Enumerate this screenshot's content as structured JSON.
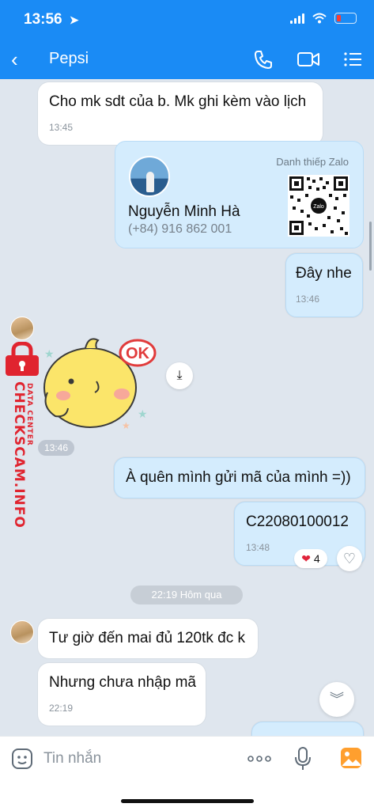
{
  "status_bar": {
    "time": "13:56"
  },
  "header": {
    "title": "Pepsi"
  },
  "messages": {
    "m1": {
      "text": "Cho mk sdt của b. Mk ghi kèm vào lịch",
      "time": "13:45"
    },
    "card": {
      "label": "Danh thiếp Zalo",
      "name": "Nguyễn Minh Hà",
      "phone": "(+84) 916 862 001",
      "qr_badge": "Zalo"
    },
    "m2": {
      "text": "Đây nhe",
      "time": "13:46"
    },
    "sticker": {
      "text": "OK",
      "time": "13:46"
    },
    "m3": {
      "text": "À quên mình gửi mã của mình =))"
    },
    "m4": {
      "text": "C22080100012",
      "time": "13:48",
      "reaction_count": "4"
    },
    "date_divider": "22:19 Hôm qua",
    "m5": {
      "text": "Tư giờ đến mai đủ 120tk đc k"
    },
    "m6": {
      "text": "Nhưng chưa nhập mã",
      "time": "22:19"
    }
  },
  "watermark": {
    "main": "CHECKSCAM.INFO",
    "sub": "DATA CENTER"
  },
  "input": {
    "placeholder": "Tin nhắn"
  },
  "colors": {
    "header": "#1a8bf5",
    "mine_bubble": "#d4ecfd",
    "background": "#dfe6ee",
    "watermark": "#e0242f"
  }
}
